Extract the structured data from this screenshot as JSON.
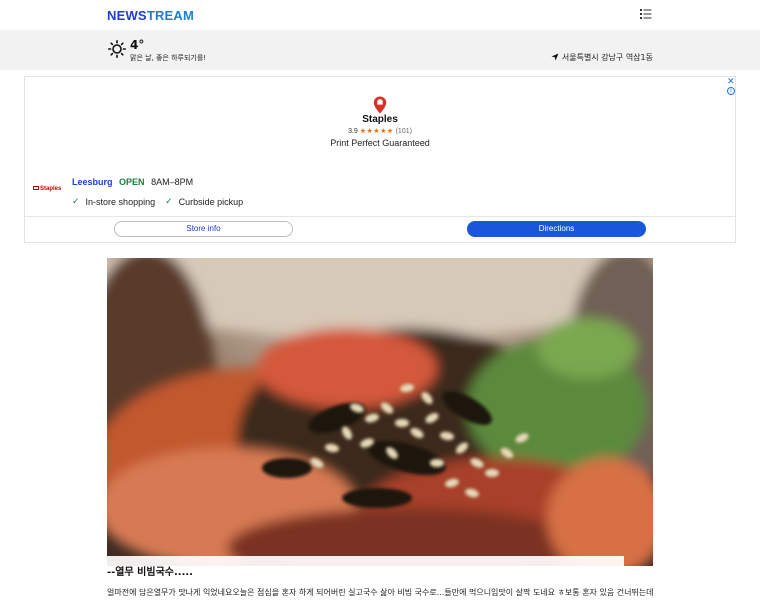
{
  "header": {
    "logo_part1": "NEWS",
    "logo_part2": "TREAM",
    "menu_icon": "list-menu-icon"
  },
  "weather": {
    "icon": "sun-icon",
    "temperature": "4°",
    "message": "맑은 날, 좋은 하루되기를!",
    "location": "서울특별시 강남구 역삼1동",
    "location_icon": "navigation-arrow-icon"
  },
  "ad": {
    "close_label": "✕",
    "info_label": "i",
    "brand": "Staples",
    "rating": "3.9",
    "stars": "★★★★★",
    "reviews": "(101)",
    "tagline": "Print Perfect Guaranteed",
    "store_logo_text": "Staples",
    "store_city": "Leesburg",
    "store_status": "OPEN",
    "store_hours": "8AM–8PM",
    "features": [
      "In-store shopping",
      "Curbside pickup"
    ],
    "store_info_label": "Store info",
    "directions_label": "Directions",
    "colors": {
      "accent": "#1a56db",
      "open": "#188038",
      "stars": "#e8710a"
    }
  },
  "article": {
    "caption": "--열무 비빔국수.....",
    "body": "얼마전에 담은열무가 맛나게 익었네요오늘은 점심을 혼자 하게 되어버린 실고국수 삶아 비빔 국수로...들만에 먹으니입맛이 살짝 도네요 ㅎ보통 혼자 있음 건너뛰는데이젠 잘 챙겨"
  }
}
